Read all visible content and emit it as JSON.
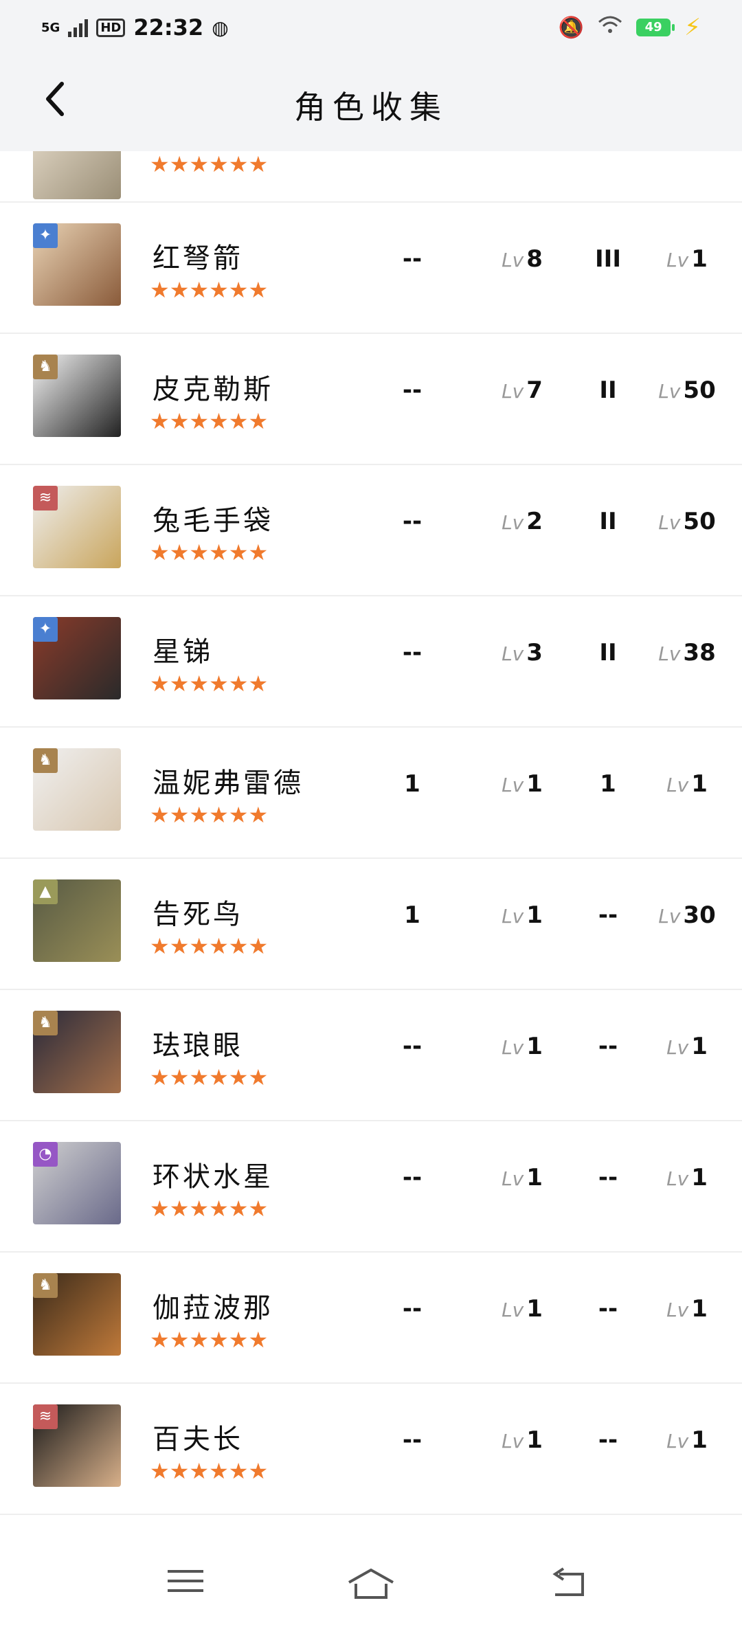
{
  "status": {
    "network": "5G",
    "hd": "HD",
    "time": "22:32",
    "battery": "49"
  },
  "header": {
    "title": "角色收集"
  },
  "colors": {
    "star": "#f07a2d",
    "element_blue": "#4a7fd1",
    "element_tan": "#a8834f",
    "element_red": "#c45a5a",
    "element_olive": "#9a9a5a",
    "element_purple": "#9657c5"
  },
  "characters": [
    {
      "name": "",
      "stars": "★★★★★★",
      "col1": "",
      "lv1": "",
      "col3": "",
      "lv2": "",
      "element": "",
      "element_icon": ""
    },
    {
      "name": "红弩箭",
      "stars": "★★★★★★",
      "col1": "--",
      "lv1": "8",
      "col3": "III",
      "lv2": "1",
      "element": "blue",
      "element_icon": "star-compass-icon"
    },
    {
      "name": "皮克勒斯",
      "stars": "★★★★★★",
      "col1": "--",
      "lv1": "7",
      "col3": "II",
      "lv2": "50",
      "element": "tan",
      "element_icon": "beast-icon"
    },
    {
      "name": "兔毛手袋",
      "stars": "★★★★★★",
      "col1": "--",
      "lv1": "2",
      "col3": "II",
      "lv2": "50",
      "element": "red",
      "element_icon": "claw-icon"
    },
    {
      "name": "星锑",
      "stars": "★★★★★★",
      "col1": "--",
      "lv1": "3",
      "col3": "II",
      "lv2": "38",
      "element": "blue",
      "element_icon": "star-compass-icon"
    },
    {
      "name": "温妮弗雷德",
      "stars": "★★★★★★",
      "col1": "1",
      "lv1": "1",
      "col3": "1",
      "lv2": "1",
      "element": "tan",
      "element_icon": "beast-icon"
    },
    {
      "name": "告死鸟",
      "stars": "★★★★★★",
      "col1": "1",
      "lv1": "1",
      "col3": "--",
      "lv2": "30",
      "element": "olive",
      "element_icon": "mineral-icon"
    },
    {
      "name": "珐琅眼",
      "stars": "★★★★★★",
      "col1": "--",
      "lv1": "1",
      "col3": "--",
      "lv2": "1",
      "element": "tan",
      "element_icon": "beast-icon"
    },
    {
      "name": "环状水星",
      "stars": "★★★★★★",
      "col1": "--",
      "lv1": "1",
      "col3": "--",
      "lv2": "1",
      "element": "purple",
      "element_icon": "spirit-icon"
    },
    {
      "name": "伽菈波那",
      "stars": "★★★★★★",
      "col1": "--",
      "lv1": "1",
      "col3": "--",
      "lv2": "1",
      "element": "tan",
      "element_icon": "beast-icon"
    },
    {
      "name": "百夫长",
      "stars": "★★★★★★",
      "col1": "--",
      "lv1": "1",
      "col3": "--",
      "lv2": "1",
      "element": "red",
      "element_icon": "claw-icon"
    }
  ],
  "labels": {
    "lv": "Lv"
  },
  "nav": {
    "menu_icon": "menu-icon",
    "home_icon": "home-icon",
    "back_icon": "back-nav-icon"
  }
}
